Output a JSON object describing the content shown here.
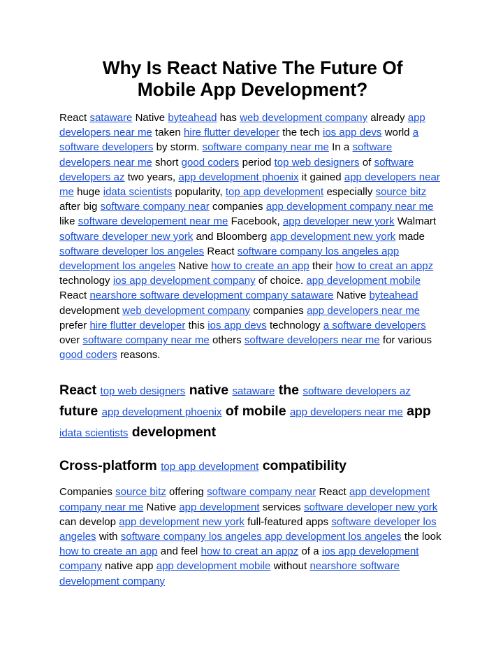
{
  "document": {
    "title": "Why Is React Native The Future Of Mobile App Development?",
    "link_color": "#1a4fd6",
    "text_color": "#000000",
    "background_color": "#ffffff",
    "paragraph1": [
      {
        "t": "React ",
        "link": false
      },
      {
        "t": "sataware",
        "link": true
      },
      {
        "t": " Native ",
        "link": false
      },
      {
        "t": "byteahead",
        "link": true
      },
      {
        "t": " has ",
        "link": false
      },
      {
        "t": "web development company",
        "link": true
      },
      {
        "t": " already ",
        "link": false
      },
      {
        "t": "app developers near me",
        "link": true
      },
      {
        "t": " taken ",
        "link": false
      },
      {
        "t": "hire flutter developer",
        "link": true
      },
      {
        "t": " the tech ",
        "link": false
      },
      {
        "t": "ios app devs",
        "link": true
      },
      {
        "t": " world ",
        "link": false
      },
      {
        "t": "a software developers",
        "link": true
      },
      {
        "t": " by storm. ",
        "link": false
      },
      {
        "t": "software company near me",
        "link": true
      },
      {
        "t": " In a ",
        "link": false
      },
      {
        "t": "software developers near me",
        "link": true
      },
      {
        "t": " short ",
        "link": false
      },
      {
        "t": "good coders",
        "link": true
      },
      {
        "t": " period ",
        "link": false
      },
      {
        "t": "top web designers",
        "link": true
      },
      {
        "t": " of ",
        "link": false
      },
      {
        "t": "software developers az",
        "link": true
      },
      {
        "t": " two years, ",
        "link": false
      },
      {
        "t": "app development phoenix",
        "link": true
      },
      {
        "t": " it gained ",
        "link": false
      },
      {
        "t": "app developers near me",
        "link": true
      },
      {
        "t": " huge ",
        "link": false
      },
      {
        "t": "idata scientists",
        "link": true
      },
      {
        "t": " popularity, ",
        "link": false
      },
      {
        "t": "top app development",
        "link": true
      },
      {
        "t": " especially ",
        "link": false
      },
      {
        "t": "source bitz",
        "link": true
      },
      {
        "t": " after big ",
        "link": false
      },
      {
        "t": "software company near",
        "link": true
      },
      {
        "t": " companies ",
        "link": false
      },
      {
        "t": "app development company near me",
        "link": true
      },
      {
        "t": " like ",
        "link": false
      },
      {
        "t": "software developement near me",
        "link": true
      },
      {
        "t": " Facebook, ",
        "link": false
      },
      {
        "t": "app developer new york",
        "link": true
      },
      {
        "t": " Walmart ",
        "link": false
      },
      {
        "t": "software developer new york",
        "link": true
      },
      {
        "t": " and Bloomberg ",
        "link": false
      },
      {
        "t": "app development new york",
        "link": true
      },
      {
        "t": " made ",
        "link": false
      },
      {
        "t": "software developer los angeles",
        "link": true
      },
      {
        "t": " React ",
        "link": false
      },
      {
        "t": "software company los angeles app development los angeles",
        "link": true
      },
      {
        "t": " Native ",
        "link": false
      },
      {
        "t": "how to create an app",
        "link": true
      },
      {
        "t": " their ",
        "link": false
      },
      {
        "t": "how to creat an appz",
        "link": true
      },
      {
        "t": " technology ",
        "link": false
      },
      {
        "t": "ios app development company",
        "link": true
      },
      {
        "t": " of choice. ",
        "link": false
      },
      {
        "t": "app development mobile",
        "link": true
      },
      {
        "t": " React ",
        "link": false
      },
      {
        "t": "nearshore software development company sataware",
        "link": true
      },
      {
        "t": " Native ",
        "link": false
      },
      {
        "t": "byteahead",
        "link": true
      },
      {
        "t": " development ",
        "link": false
      },
      {
        "t": "web development company",
        "link": true
      },
      {
        "t": " companies ",
        "link": false
      },
      {
        "t": "app developers near me",
        "link": true
      },
      {
        "t": " prefer ",
        "link": false
      },
      {
        "t": "hire flutter developer",
        "link": true
      },
      {
        "t": " this ",
        "link": false
      },
      {
        "t": "ios app devs",
        "link": true
      },
      {
        "t": " technology ",
        "link": false
      },
      {
        "t": "a software developers",
        "link": true
      },
      {
        "t": " over ",
        "link": false
      },
      {
        "t": "software company near me",
        "link": true
      },
      {
        "t": " others ",
        "link": false
      },
      {
        "t": "software developers near me",
        "link": true
      },
      {
        "t": " for various ",
        "link": false
      },
      {
        "t": "good coders",
        "link": true
      },
      {
        "t": " reasons.",
        "link": false
      }
    ],
    "heading2": [
      {
        "t": "React ",
        "link": false
      },
      {
        "t": "top web designers",
        "link": true
      },
      {
        "t": " native ",
        "link": false
      },
      {
        "t": "sataware",
        "link": true
      },
      {
        "t": " the ",
        "link": false
      },
      {
        "t": "software developers az",
        "link": true
      },
      {
        "t": " future ",
        "link": false
      },
      {
        "t": "app development phoenix",
        "link": true
      },
      {
        "t": " of mobile ",
        "link": false
      },
      {
        "t": "app developers near me",
        "link": true
      },
      {
        "t": " app ",
        "link": false
      },
      {
        "t": "idata scientists",
        "link": true
      },
      {
        "t": " development",
        "link": false
      }
    ],
    "heading3": [
      {
        "t": "Cross-platform ",
        "link": false
      },
      {
        "t": "top app development",
        "link": true
      },
      {
        "t": " compatibility",
        "link": false
      }
    ],
    "paragraph2": [
      {
        "t": "Companies ",
        "link": false
      },
      {
        "t": "source bitz",
        "link": true
      },
      {
        "t": " offering ",
        "link": false
      },
      {
        "t": "software company near",
        "link": true
      },
      {
        "t": " React ",
        "link": false
      },
      {
        "t": "app development company near me",
        "link": true
      },
      {
        "t": " Native ",
        "link": false
      },
      {
        "t": "app development",
        "link": true
      },
      {
        "t": " services ",
        "link": false
      },
      {
        "t": "software developer new york",
        "link": true
      },
      {
        "t": " can develop ",
        "link": false
      },
      {
        "t": "app development new york",
        "link": true
      },
      {
        "t": " full-featured apps ",
        "link": false
      },
      {
        "t": "software developer los angeles",
        "link": true
      },
      {
        "t": " with ",
        "link": false
      },
      {
        "t": "software company los angeles app development los angeles",
        "link": true
      },
      {
        "t": " the look ",
        "link": false
      },
      {
        "t": "how to create an app",
        "link": true
      },
      {
        "t": " and feel ",
        "link": false
      },
      {
        "t": "how to creat an appz",
        "link": true
      },
      {
        "t": " of a ",
        "link": false
      },
      {
        "t": "ios app development company",
        "link": true
      },
      {
        "t": " native app ",
        "link": false
      },
      {
        "t": "app development mobile",
        "link": true
      },
      {
        "t": " without ",
        "link": false
      },
      {
        "t": "nearshore software development company",
        "link": true
      }
    ]
  }
}
